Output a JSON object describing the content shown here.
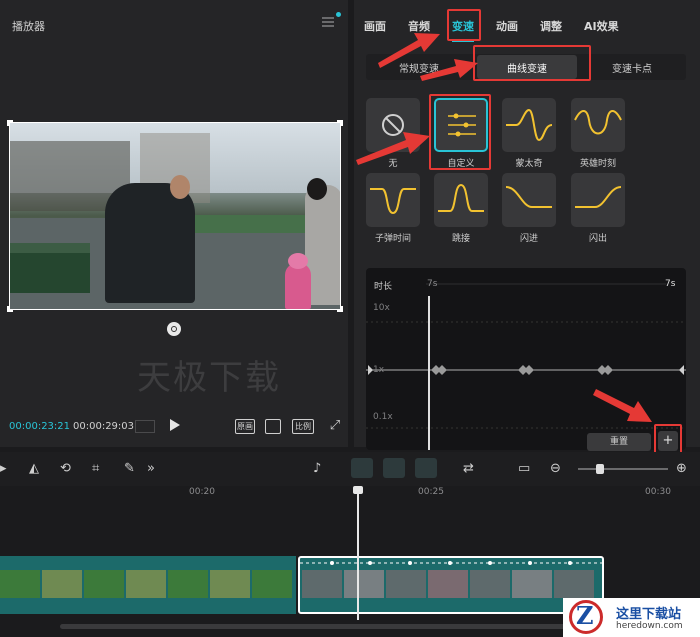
{
  "player": {
    "title": "播放器",
    "watermark": "天极下载",
    "time_current": "00:00:23:21",
    "time_total": "00:00:29:03",
    "controls": [
      "原画",
      "比例"
    ]
  },
  "props": {
    "tabs": [
      "画面",
      "音频",
      "变速",
      "动画",
      "调整",
      "AI效果"
    ],
    "active_tab": "变速",
    "subtabs": [
      "常规变速",
      "曲线变速",
      "变速卡点"
    ],
    "active_subtab": "曲线变速",
    "presets": [
      {
        "label": "无",
        "icon": "none-icon"
      },
      {
        "label": "自定义",
        "icon": "custom-sliders-icon",
        "selected": true
      },
      {
        "label": "蒙太奇",
        "icon": "montage-curve-icon"
      },
      {
        "label": "英雄时刻",
        "icon": "hero-moment-curve-icon"
      },
      {
        "label": "子弹时间",
        "icon": "bullet-time-curve-icon"
      },
      {
        "label": "跳接",
        "icon": "jump-cut-curve-icon"
      },
      {
        "label": "闪进",
        "icon": "flash-in-curve-icon"
      },
      {
        "label": "闪出",
        "icon": "flash-out-curve-icon"
      }
    ],
    "curve": {
      "duration_label": "时长",
      "duration_start": "7s",
      "duration_end": "7s",
      "y_labels": [
        "10x",
        "1x",
        "0.1x"
      ]
    },
    "reset_label": "重置",
    "add_label": "+"
  },
  "timeline": {
    "ticks": [
      "00:20",
      "00:25",
      "00:30"
    ]
  },
  "logo": {
    "title": "这里下载站",
    "url": "heredown.com",
    "glyph": "Z"
  },
  "colors": {
    "accent": "#29c4d6",
    "highlight_red": "#e53935",
    "curve_yellow": "#f2c230",
    "clip_teal": "#1c6a6a"
  }
}
